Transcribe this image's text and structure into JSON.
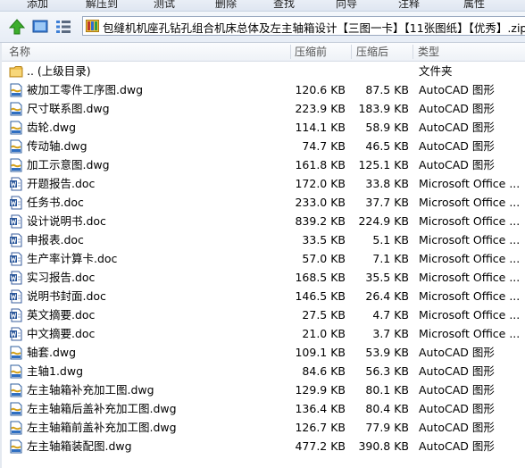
{
  "toolbar": {
    "items": [
      "添加",
      "解压到",
      "测试",
      "删除",
      "查找",
      "向导",
      "注释",
      "属性"
    ]
  },
  "address": {
    "path": "包缝机机座孔钻孔组合机床总体及左主轴箱设计【三图一卡】【11张图纸】【优秀】.zip -"
  },
  "columns": {
    "name": "名称",
    "size": "压缩前",
    "packed": "压缩后",
    "type": "类型"
  },
  "parent_row": {
    "name": ".. (上级目录)",
    "type": "文件夹"
  },
  "files": [
    {
      "name": "被加工零件工序图.dwg",
      "size": "120.6 KB",
      "packed": "87.5 KB",
      "type": "AutoCAD 图形",
      "icon": "dwg-file-icon"
    },
    {
      "name": "尺寸联系图.dwg",
      "size": "223.9 KB",
      "packed": "183.9 KB",
      "type": "AutoCAD 图形",
      "icon": "dwg-file-icon"
    },
    {
      "name": "齿轮.dwg",
      "size": "114.1 KB",
      "packed": "58.9 KB",
      "type": "AutoCAD 图形",
      "icon": "dwg-file-icon"
    },
    {
      "name": "传动轴.dwg",
      "size": "74.7 KB",
      "packed": "46.5 KB",
      "type": "AutoCAD 图形",
      "icon": "dwg-file-icon"
    },
    {
      "name": "加工示意图.dwg",
      "size": "161.8 KB",
      "packed": "125.1 KB",
      "type": "AutoCAD 图形",
      "icon": "dwg-file-icon"
    },
    {
      "name": "开题报告.doc",
      "size": "172.0 KB",
      "packed": "33.8 KB",
      "type": "Microsoft Office ...",
      "icon": "word-doc-icon"
    },
    {
      "name": "任务书.doc",
      "size": "233.0 KB",
      "packed": "37.7 KB",
      "type": "Microsoft Office ...",
      "icon": "word-doc-icon"
    },
    {
      "name": "设计说明书.doc",
      "size": "839.2 KB",
      "packed": "224.9 KB",
      "type": "Microsoft Office ...",
      "icon": "word-doc-icon"
    },
    {
      "name": "申报表.doc",
      "size": "33.5 KB",
      "packed": "5.1 KB",
      "type": "Microsoft Office ...",
      "icon": "word-doc-icon"
    },
    {
      "name": "生产率计算卡.doc",
      "size": "57.0 KB",
      "packed": "7.1 KB",
      "type": "Microsoft Office ...",
      "icon": "word-doc-icon"
    },
    {
      "name": "实习报告.doc",
      "size": "168.5 KB",
      "packed": "35.5 KB",
      "type": "Microsoft Office ...",
      "icon": "word-doc-icon"
    },
    {
      "name": "说明书封面.doc",
      "size": "146.5 KB",
      "packed": "26.4 KB",
      "type": "Microsoft Office ...",
      "icon": "word-doc-icon"
    },
    {
      "name": "英文摘要.doc",
      "size": "27.5 KB",
      "packed": "4.7 KB",
      "type": "Microsoft Office ...",
      "icon": "word-doc-icon"
    },
    {
      "name": "中文摘要.doc",
      "size": "21.0 KB",
      "packed": "3.7 KB",
      "type": "Microsoft Office ...",
      "icon": "word-doc-icon"
    },
    {
      "name": "轴套.dwg",
      "size": "109.1 KB",
      "packed": "53.9 KB",
      "type": "AutoCAD 图形",
      "icon": "dwg-file-icon"
    },
    {
      "name": "主轴1.dwg",
      "size": "84.6 KB",
      "packed": "56.3 KB",
      "type": "AutoCAD 图形",
      "icon": "dwg-file-icon"
    },
    {
      "name": "左主轴箱补充加工图.dwg",
      "size": "129.9 KB",
      "packed": "80.1 KB",
      "type": "AutoCAD 图形",
      "icon": "dwg-file-icon"
    },
    {
      "name": "左主轴箱后盖补充加工图.dwg",
      "size": "136.4 KB",
      "packed": "80.4 KB",
      "type": "AutoCAD 图形",
      "icon": "dwg-file-icon"
    },
    {
      "name": "左主轴箱前盖补充加工图.dwg",
      "size": "126.7 KB",
      "packed": "77.9 KB",
      "type": "AutoCAD 图形",
      "icon": "dwg-file-icon"
    },
    {
      "name": "左主轴箱装配图.dwg",
      "size": "477.2 KB",
      "packed": "390.8 KB",
      "type": "AutoCAD 图形",
      "icon": "dwg-file-icon"
    }
  ]
}
